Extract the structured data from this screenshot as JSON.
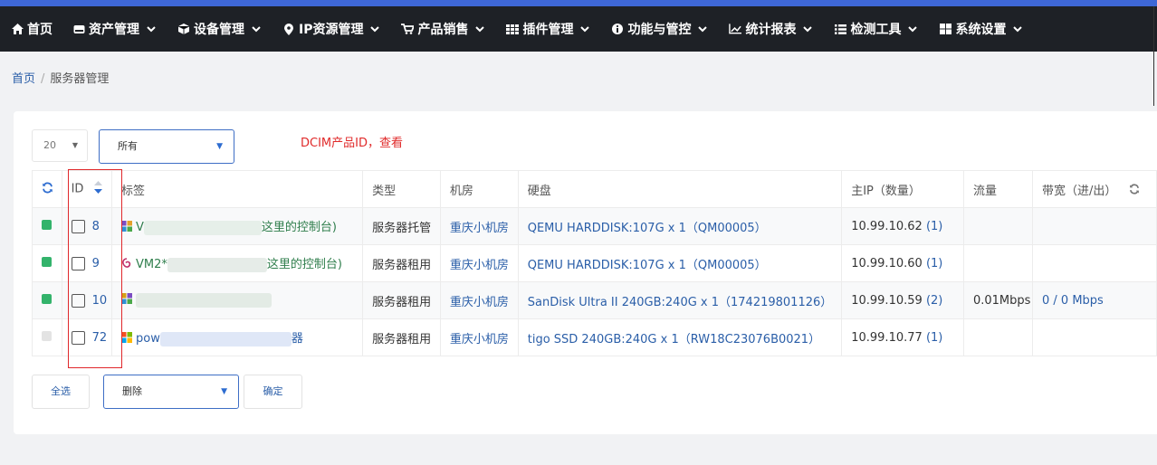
{
  "nav": [
    {
      "label": "首页",
      "icon": "home-icon"
    },
    {
      "label": "资产管理",
      "icon": "hdd-icon"
    },
    {
      "label": "设备管理",
      "icon": "cube-icon"
    },
    {
      "label": "IP资源管理",
      "icon": "map-marker-icon"
    },
    {
      "label": "产品销售",
      "icon": "cart-icon"
    },
    {
      "label": "插件管理",
      "icon": "grid-icon"
    },
    {
      "label": "功能与管控",
      "icon": "info-icon"
    },
    {
      "label": "统计报表",
      "icon": "chart-icon"
    },
    {
      "label": "检测工具",
      "icon": "list-icon"
    },
    {
      "label": "系统设置",
      "icon": "windows-icon"
    }
  ],
  "breadcrumb": {
    "home": "首页",
    "separator": "/",
    "current": "服务器管理"
  },
  "controls": {
    "page_size": "20",
    "filter": "所有",
    "note": "DCIM产品ID，查看"
  },
  "table": {
    "headers": [
      "ID",
      "标签",
      "类型",
      "机房",
      "硬盘",
      "主IP（数量）",
      "流量",
      "带宽（进/出）"
    ],
    "rows": [
      {
        "status_color": "#33b36b",
        "id": "8",
        "label_prefix": "V",
        "label_suffix": "这里的控制台)",
        "type": "服务器托管",
        "room": "重庆小机房",
        "disk": "QEMU HARDDISK:107G x 1（QM00005）",
        "ip": "10.99.10.62",
        "ip_count": "(1)",
        "traffic": "",
        "bandwidth": ""
      },
      {
        "status_color": "#33b36b",
        "id": "9",
        "label_prefix": "VM2*",
        "label_suffix": "这里的控制台)",
        "type": "服务器租用",
        "room": "重庆小机房",
        "disk": "QEMU HARDDISK:107G x 1（QM00005）",
        "ip": "10.99.10.60",
        "ip_count": "(1)",
        "traffic": "",
        "bandwidth": ""
      },
      {
        "status_color": "#33b36b",
        "id": "10",
        "label_prefix": "",
        "label_suffix": "",
        "type": "服务器租用",
        "room": "重庆小机房",
        "disk": "SanDisk Ultra II 240GB:240G x 1（174219801126）",
        "ip": "10.99.10.59",
        "ip_count": "(2)",
        "traffic": "0.01Mbps",
        "bandwidth": "0 / 0 Mbps"
      },
      {
        "status_color": "#e3e3e3",
        "id": "72",
        "label_prefix": "pow",
        "label_suffix": "器",
        "type": "服务器租用",
        "room": "重庆小机房",
        "disk": "tigo SSD 240GB:240G x 1（RW18C23076B0021）",
        "ip": "10.99.10.77",
        "ip_count": "(1)",
        "traffic": "",
        "bandwidth": ""
      }
    ]
  },
  "actions": {
    "select_all": "全选",
    "batch_action": "删除",
    "confirm": "确定"
  }
}
